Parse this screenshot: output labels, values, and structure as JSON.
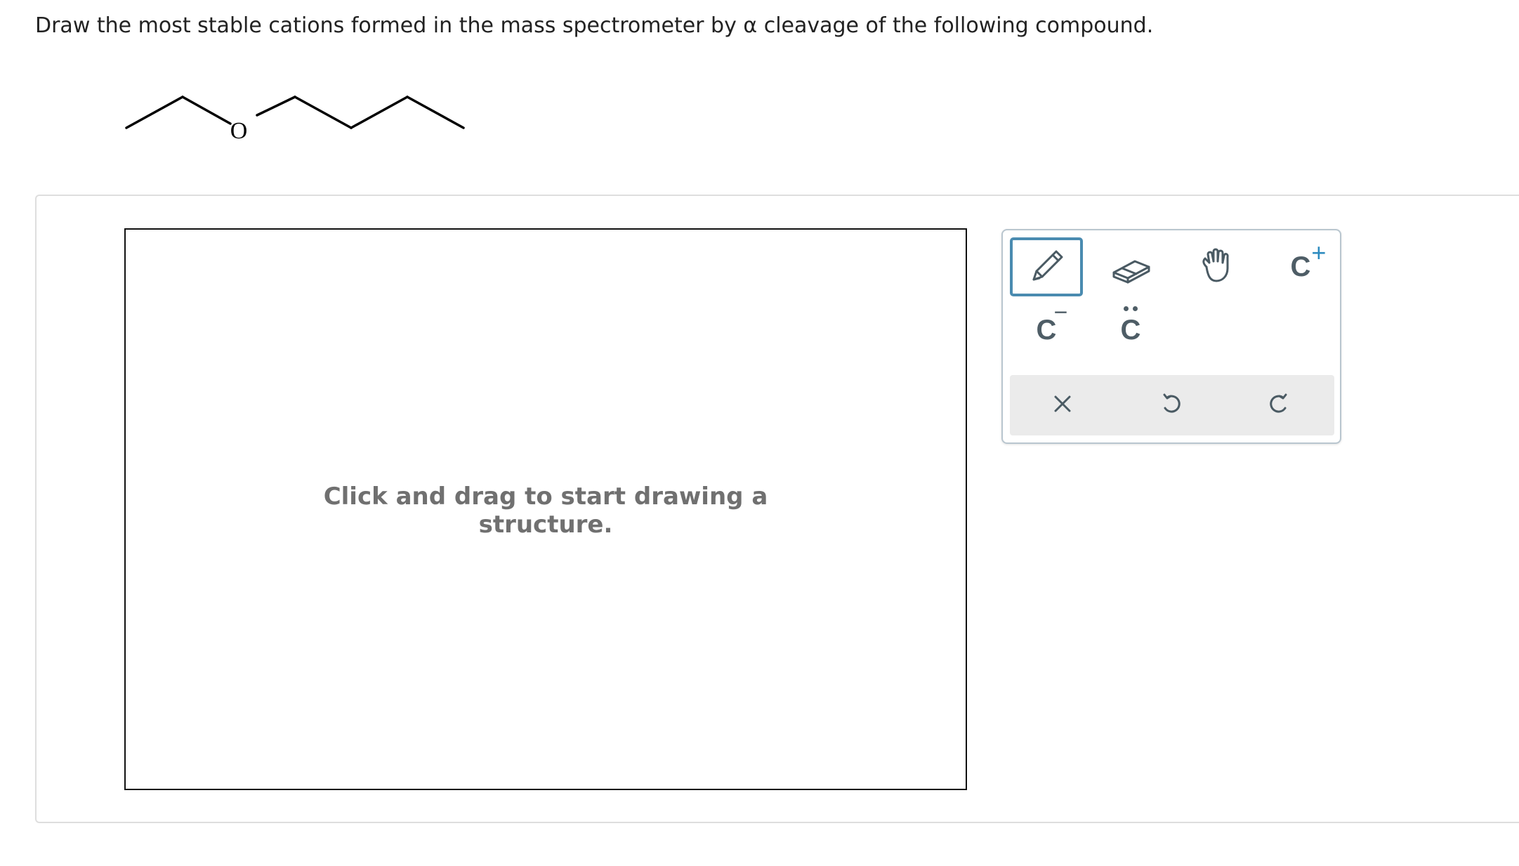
{
  "question": {
    "text": "Draw the most stable cations formed in the mass spectrometer by α cleavage of the following compound."
  },
  "molecule": {
    "atom_label": "O"
  },
  "canvas": {
    "hint": "Click and drag to start drawing a structure."
  },
  "toolbox": {
    "tools": [
      {
        "name": "pencil",
        "icon": "pencil-icon",
        "active": true
      },
      {
        "name": "eraser",
        "icon": "eraser-icon",
        "active": false
      },
      {
        "name": "move",
        "icon": "hand-icon",
        "active": false
      },
      {
        "name": "positive-charge",
        "label": "C",
        "superscript": "+"
      },
      {
        "name": "negative-charge",
        "label": "C",
        "superscript": "−"
      },
      {
        "name": "lone-pair",
        "label": "C",
        "superscript": "••"
      }
    ],
    "actions": [
      {
        "name": "clear",
        "icon": "close-icon"
      },
      {
        "name": "undo",
        "icon": "undo-icon"
      },
      {
        "name": "redo",
        "icon": "redo-icon"
      }
    ]
  },
  "colors": {
    "active_border": "#4a8bb0",
    "icon": "#4a5a63",
    "plus": "#2c8bbf",
    "hint_text": "#707070",
    "action_bar_bg": "#ebebeb"
  }
}
